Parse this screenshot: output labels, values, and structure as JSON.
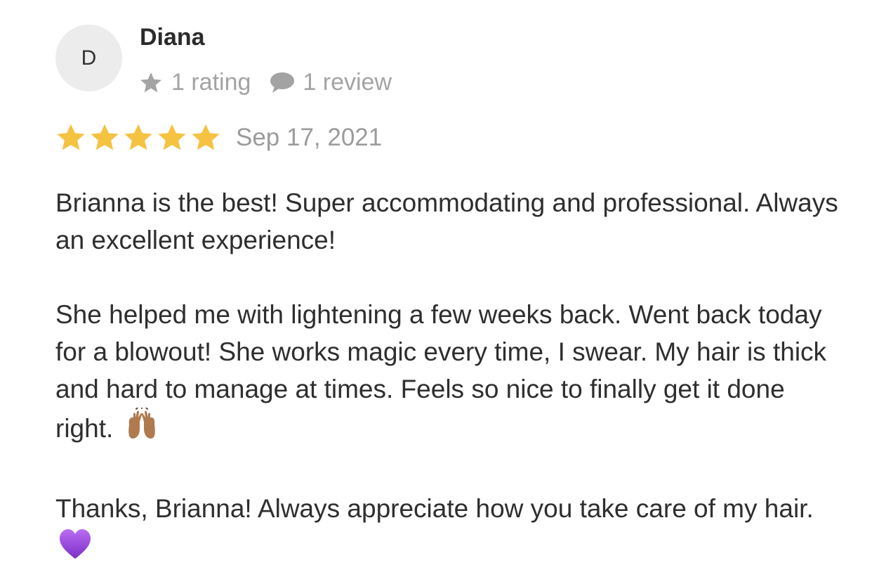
{
  "reviewer": {
    "initial": "D",
    "name": "Diana",
    "ratings_label": "1 rating",
    "reviews_label": "1 review"
  },
  "review": {
    "rating": 5,
    "max_rating": 5,
    "date": "Sep 17, 2021",
    "paragraphs": [
      "Brianna is the best! Super accommodating and professional. Always an excellent experience!",
      "She helped me with lightening a few weeks back. Went back today for a blowout! She works magic every time, I swear. My hair is thick and hard to manage at times. Feels so nice to finally get it done right.",
      "Thanks, Brianna! Always appreciate how you take care of my hair."
    ],
    "paragraph_emojis": [
      "",
      "raising-hands-emoji",
      "purple-heart-emoji"
    ]
  },
  "icons": {
    "rating_stat_icon": "star-icon",
    "review_stat_icon": "speech-bubble-icon",
    "star_color": "#f5c242",
    "stat_icon_color": "#a3a3a3"
  }
}
